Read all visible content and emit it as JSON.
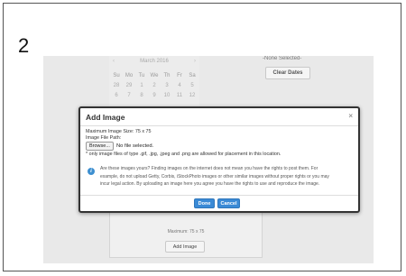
{
  "step_number": "2",
  "calendar": {
    "month_label": "March 2016",
    "prev_arrow": "‹",
    "next_arrow": "›",
    "days_of_week": [
      "Su",
      "Mo",
      "Tu",
      "We",
      "Th",
      "Fr",
      "Sa"
    ],
    "week1": [
      "28",
      "29",
      "1",
      "2",
      "3",
      "4",
      "5"
    ],
    "week2": [
      "6",
      "7",
      "8",
      "9",
      "10",
      "11",
      "12"
    ]
  },
  "date_filter": {
    "none_selected": "-None Selected-",
    "clear_dates_label": "Clear Dates"
  },
  "image_panel": {
    "max_size_text": "Maximum: 75 x 75",
    "add_image_label": "Add Image"
  },
  "modal": {
    "title": "Add Image",
    "close_glyph": "×",
    "max_image_size": "Maximum Image Size: 75 x 75",
    "file_path_label": "Image File Path:",
    "browse_label": "Browse...",
    "no_file_text": "No file selected.",
    "file_types_note": "* only image files of type .gif, .jpg, .jpeg and .png are allowed for placement in this location.",
    "notice_line1": "Are these images yours? Finding images on the internet does not mean you have the rights to post them. For",
    "notice_line2": "example, do not upload Getty, Corbis, iStockPhoto images or other similar images without proper rights or you may",
    "notice_line3": "incur legal action. By uploading an image here you agree you have the rights to use and reproduce the image.",
    "done_label": "Done",
    "cancel_label": "Cancel"
  },
  "colors": {
    "primary_button": "#3a8ad6",
    "info_icon": "#3d8fd0",
    "backdrop": "#e9e9e9"
  }
}
